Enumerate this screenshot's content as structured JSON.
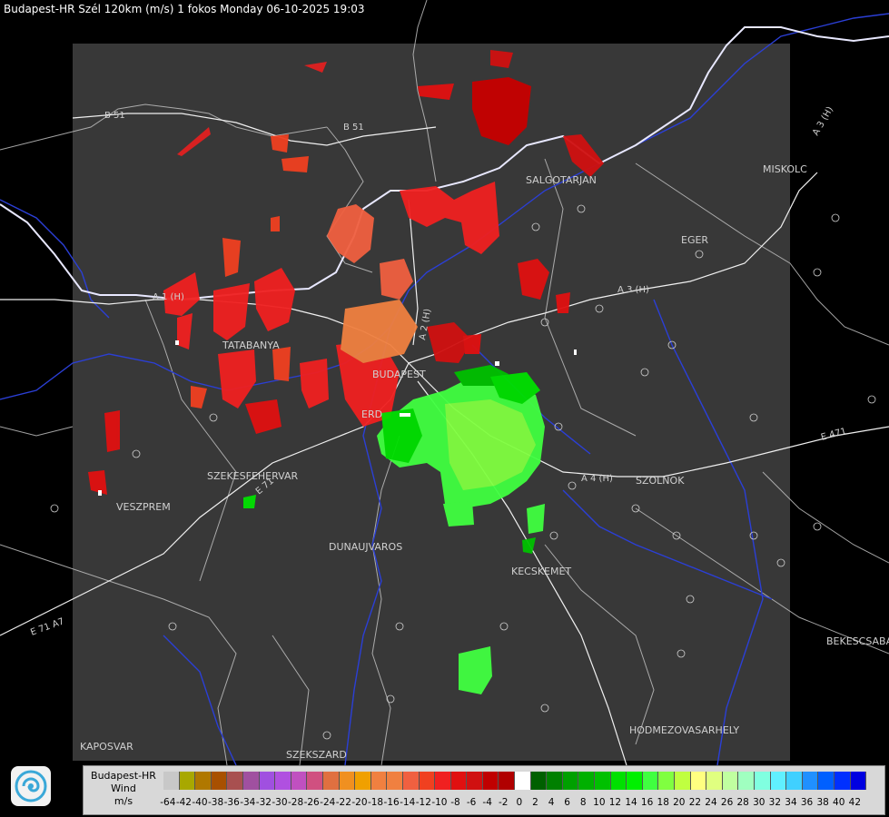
{
  "header": {
    "title": "Budapest-HR Szél 120km (m/s) 1 fokos Monday 06-10-2025 19:03"
  },
  "cities": [
    {
      "name": "SALGOTARJAN"
    },
    {
      "name": "MISKOLC"
    },
    {
      "name": "EGER"
    },
    {
      "name": "TATABANYA"
    },
    {
      "name": "BUDAPEST"
    },
    {
      "name": "ERD"
    },
    {
      "name": "SZEKESFEHERVAR"
    },
    {
      "name": "VESZPREM"
    },
    {
      "name": "DUNAUJVAROS"
    },
    {
      "name": "KECSKEMET"
    },
    {
      "name": "SZOLNOK"
    },
    {
      "name": "BEKESCSABA"
    },
    {
      "name": "HODMEZOVASARHELY"
    },
    {
      "name": "KAPOSVAR"
    },
    {
      "name": "SZEKSZARD"
    }
  ],
  "road_labels": [
    "B 51",
    "B 51",
    "A 3 (H)",
    "A 3 (H)",
    "A 1 (H)",
    "A 2 (H)",
    "A 4 (H)",
    "E 71",
    "E 71 A7",
    "E 471"
  ],
  "legend": {
    "line1": "Budapest-HR",
    "line2": "Wind",
    "line3": "m/s",
    "ticks": [
      "-64",
      "-42",
      "-40",
      "-38",
      "-36",
      "-34",
      "-32",
      "-30",
      "-28",
      "-26",
      "-24",
      "-22",
      "-20",
      "-18",
      "-16",
      "-14",
      "-12",
      "-10",
      "-8",
      "-6",
      "-4",
      "-2",
      "0",
      "2",
      "4",
      "6",
      "8",
      "10",
      "12",
      "14",
      "16",
      "18",
      "20",
      "22",
      "24",
      "26",
      "28",
      "30",
      "32",
      "34",
      "36",
      "38",
      "40",
      "42"
    ],
    "colors": [
      "#c8c8c8",
      "#a8a800",
      "#b07800",
      "#a85000",
      "#a85050",
      "#a050a0",
      "#a050e0",
      "#b050e0",
      "#c050c0",
      "#d05080",
      "#e07040",
      "#f09020",
      "#f0a000",
      "#f08040",
      "#f08040",
      "#f06040",
      "#f04020",
      "#f02020",
      "#e01010",
      "#d01010",
      "#c00000",
      "#b00000",
      "#ffffff",
      "#006000",
      "#008000",
      "#00a000",
      "#00b000",
      "#00c000",
      "#00e000",
      "#00f000",
      "#40ff40",
      "#80ff40",
      "#c0ff40",
      "#ffff80",
      "#e0ff80",
      "#c0ffa0",
      "#a0ffc0",
      "#80ffe0",
      "#60f0ff",
      "#40d0ff",
      "#2090ff",
      "#0060ff",
      "#0030ff",
      "#0000e0"
    ]
  },
  "logo": {
    "icon": "weather-service-swirl-logo"
  }
}
